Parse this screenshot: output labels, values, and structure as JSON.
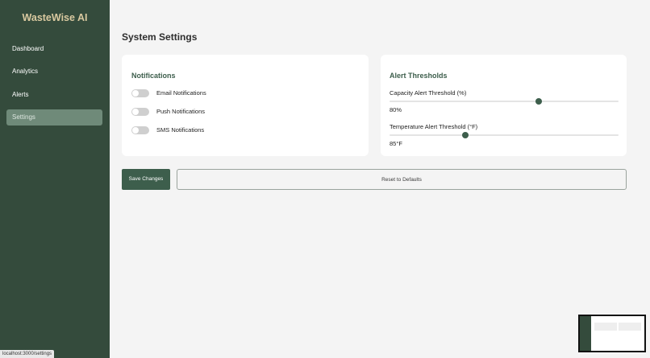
{
  "app": {
    "brand": "WasteWise AI"
  },
  "sidebar": {
    "items": [
      {
        "label": "Dashboard",
        "active": false
      },
      {
        "label": "Analytics",
        "active": false
      },
      {
        "label": "Alerts",
        "active": false
      },
      {
        "label": "Settings",
        "active": true
      }
    ]
  },
  "page": {
    "title": "System Settings"
  },
  "notifications": {
    "title": "Notifications",
    "items": [
      {
        "label": "Email Notifications",
        "enabled": false
      },
      {
        "label": "Push Notifications",
        "enabled": false
      },
      {
        "label": "SMS Notifications",
        "enabled": false
      }
    ]
  },
  "thresholds": {
    "title": "Alert Thresholds",
    "capacity": {
      "label": "Capacity Alert Threshold (%)",
      "value_text": "80%",
      "level": 0.65
    },
    "temperature": {
      "label": "Temperature Alert Threshold (°F)",
      "value_text": "85°F",
      "level": 0.33
    }
  },
  "actions": {
    "save_label": "Save Changes",
    "reset_label": "Reset to Defaults"
  },
  "status_bar": {
    "url": "localhost:3000/settings"
  },
  "colors": {
    "sidebar": "#344b3c",
    "accent": "#3d5e4c",
    "brand": "#d9c9a0",
    "active_item": "#6f8a79"
  }
}
